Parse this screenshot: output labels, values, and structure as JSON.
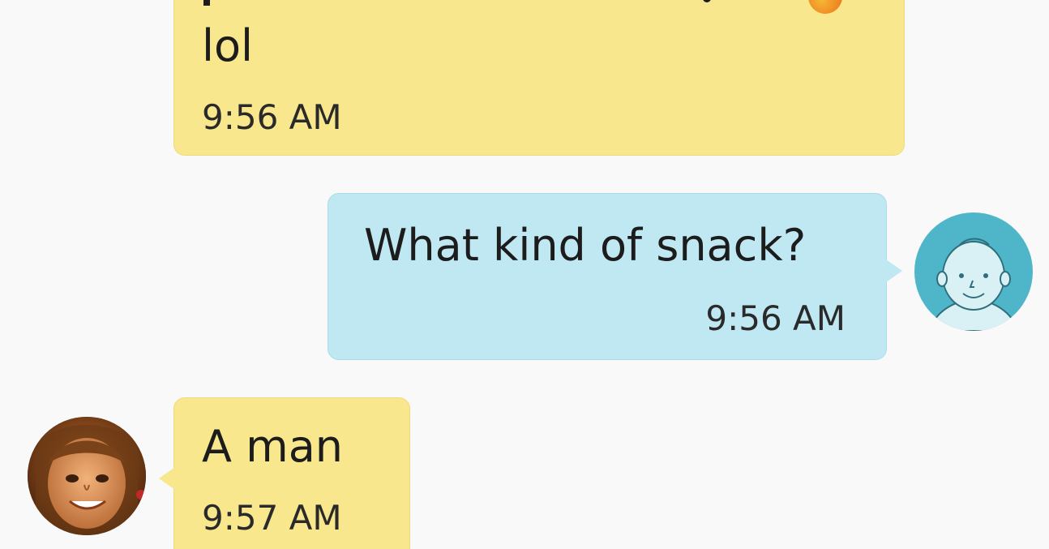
{
  "conversation": {
    "messages": [
      {
        "direction": "incoming",
        "text": "lol",
        "time": "9:56 AM"
      },
      {
        "direction": "outgoing",
        "text": "What kind of snack?",
        "time": "9:56 AM"
      },
      {
        "direction": "incoming",
        "text": "A man",
        "time": "9:57 AM"
      }
    ]
  },
  "avatars": {
    "self": "person-placeholder-icon",
    "contact": "contact-photo"
  },
  "colors": {
    "incoming_bubble": "#f8e78c",
    "outgoing_bubble": "#bfe8f2",
    "self_avatar": "#4fb6c9",
    "background": "#f9f9f9"
  }
}
